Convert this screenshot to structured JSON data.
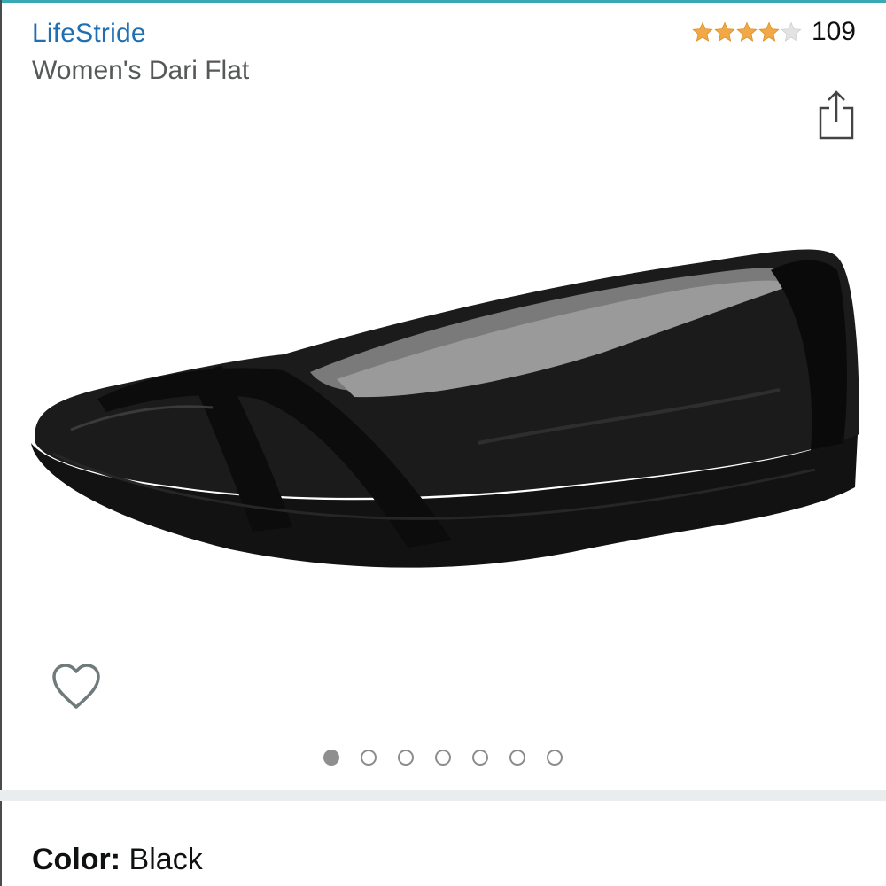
{
  "product": {
    "brand": "LifeStride",
    "title": "Women's Dari Flat",
    "rating_value": 4,
    "rating_max": 5,
    "rating_count": "109"
  },
  "gallery": {
    "image_alt": "Black women's flat shoe",
    "image_count": 7,
    "active_index": 0
  },
  "variation": {
    "color_label": "Color:",
    "color_value": "Black"
  },
  "icons": {
    "share": "share-icon",
    "wishlist": "heart-outline-icon",
    "star_filled": "star-filled-icon",
    "star_empty": "star-empty-icon"
  },
  "colors": {
    "brand_link": "#1f6fb3",
    "star": "#f3a847",
    "star_empty": "#dddddd",
    "accent_rule": "#3aa9b6"
  }
}
